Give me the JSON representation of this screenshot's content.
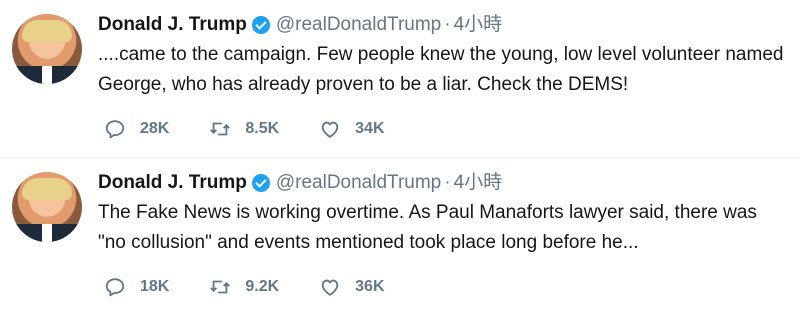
{
  "tweets": [
    {
      "name": "Donald J. Trump",
      "handle": "@realDonaldTrump",
      "separator": "·",
      "time": "4小時",
      "text": "....came to the campaign. Few people knew the young, low level volunteer named George, who has already proven to be a liar. Check the DEMS!",
      "replies": "28K",
      "retweets": "8.5K",
      "likes": "34K"
    },
    {
      "name": "Donald J. Trump",
      "handle": "@realDonaldTrump",
      "separator": "·",
      "time": "4小時",
      "text": "The Fake News is working overtime. As Paul Manaforts lawyer said, there was \"no collusion\" and events mentioned took place long before he...",
      "replies": "18K",
      "retweets": "9.2K",
      "likes": "36K"
    }
  ],
  "colors": {
    "name": "#14171a",
    "muted": "#657786",
    "verified": "#1da1f2",
    "divider": "#e6ecf0"
  },
  "icons": [
    "verified-badge-icon",
    "reply-icon",
    "retweet-icon",
    "like-icon"
  ]
}
